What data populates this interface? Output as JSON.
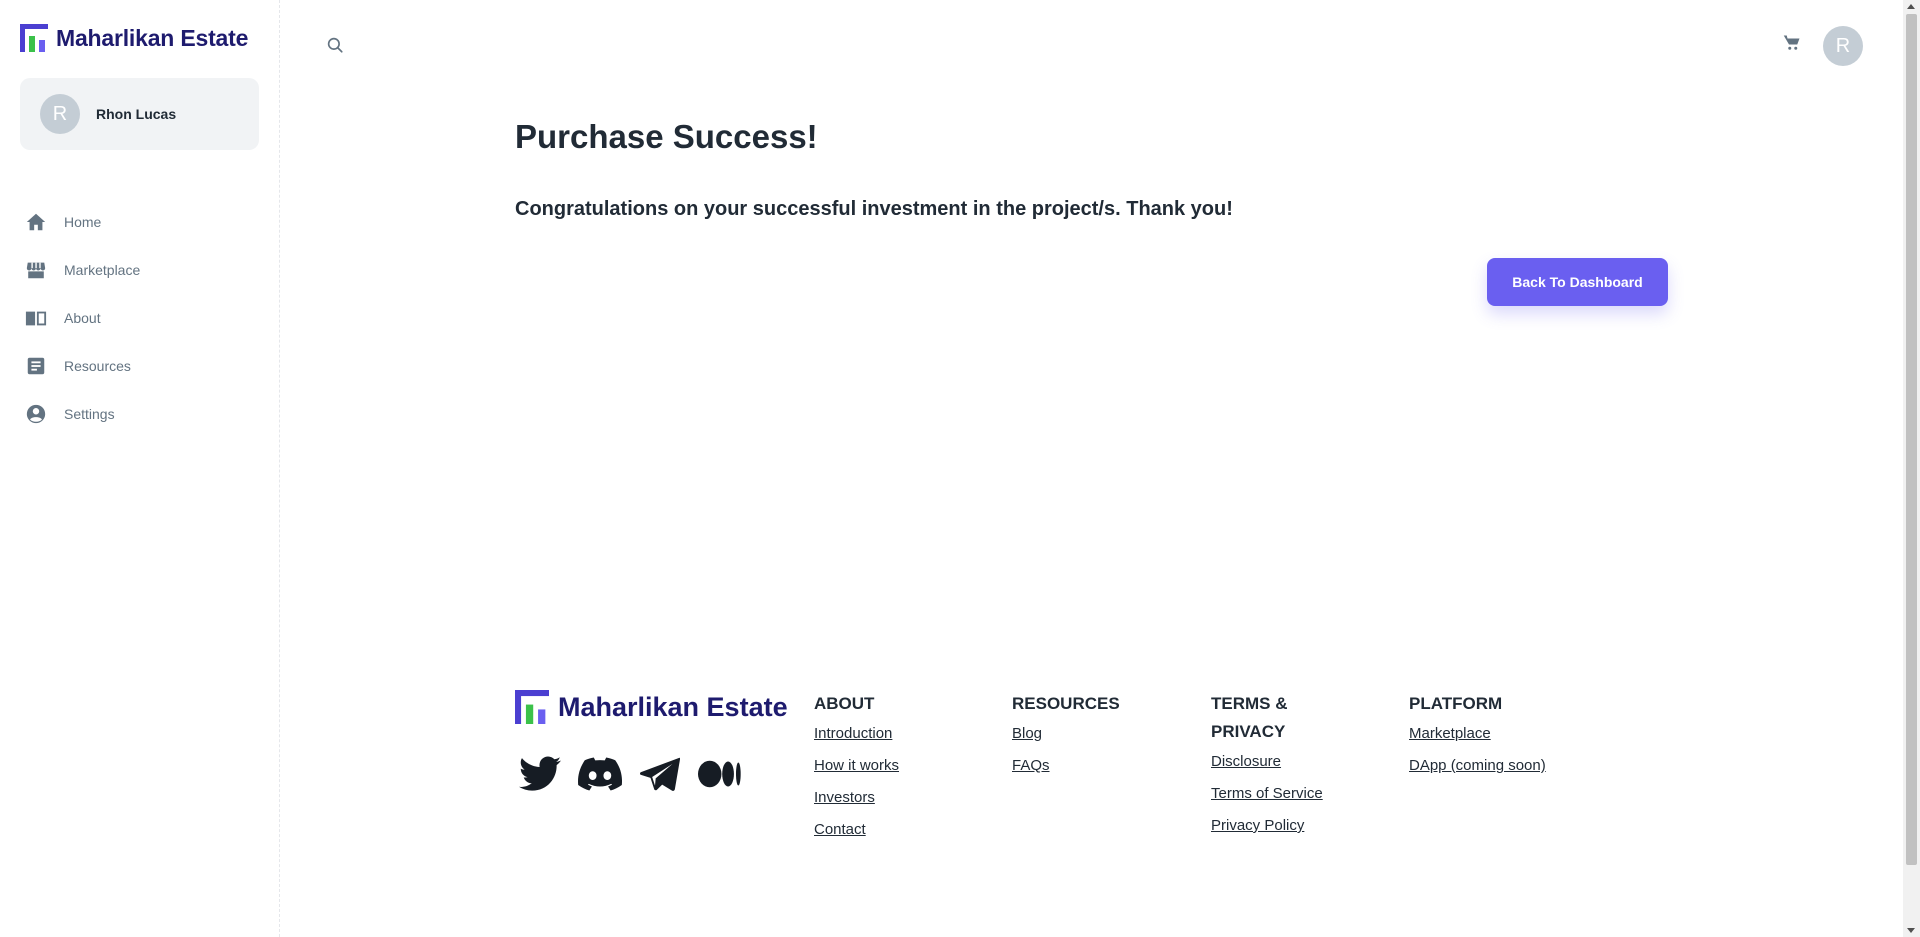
{
  "brand": {
    "name": "Maharlikan Estate"
  },
  "user": {
    "initial": "R",
    "name": "Rhon Lucas"
  },
  "nav": {
    "items": [
      {
        "label": "Home",
        "icon": "home-icon"
      },
      {
        "label": "Marketplace",
        "icon": "store-icon"
      },
      {
        "label": "About",
        "icon": "book-icon"
      },
      {
        "label": "Resources",
        "icon": "document-icon"
      },
      {
        "label": "Settings",
        "icon": "account-circle-icon"
      }
    ]
  },
  "topbar": {
    "search_icon": "search-icon",
    "cart_icon": "cart-icon",
    "avatar_initial": "R"
  },
  "main": {
    "title": "Purchase Success!",
    "message": "Congratulations on your successful investment in the project/s. Thank you!",
    "back_button": "Back To Dashboard"
  },
  "footer": {
    "brand": "Maharlikan Estate",
    "socials": [
      "twitter-icon",
      "discord-icon",
      "telegram-icon",
      "medium-icon"
    ],
    "columns": [
      {
        "title": "ABOUT",
        "links": [
          "Introduction",
          "How it works",
          "Investors",
          "Contact"
        ]
      },
      {
        "title": "RESOURCES",
        "links": [
          "Blog",
          "FAQs"
        ]
      },
      {
        "title": "TERMS & PRIVACY",
        "links": [
          "Disclosure",
          "Terms of Service",
          "Privacy Policy"
        ]
      },
      {
        "title": "PLATFORM",
        "links": [
          "Marketplace",
          "DApp (coming soon)"
        ]
      }
    ]
  },
  "colors": {
    "brand_dark": "#1e1b6e",
    "accent": "#6a5ff0",
    "logo_green": "#3bc14a"
  }
}
